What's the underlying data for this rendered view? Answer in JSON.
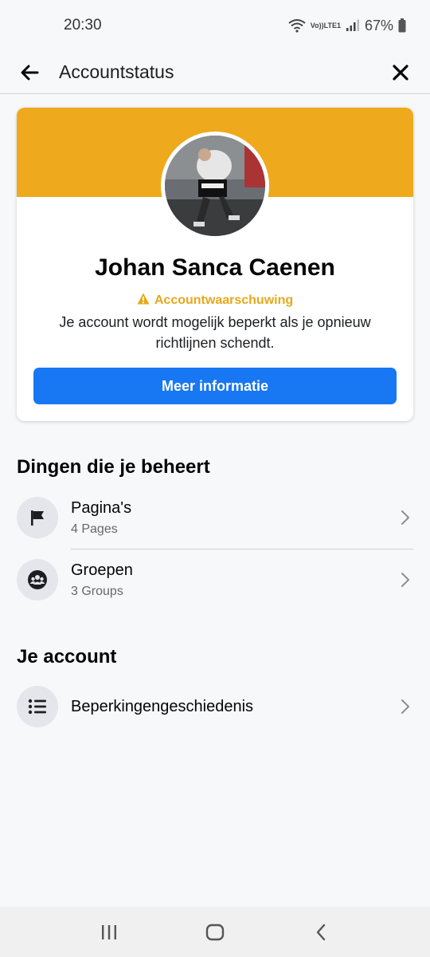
{
  "status_bar": {
    "time": "20:30",
    "volte_top": "Vo))",
    "volte_bottom": "LTE1",
    "battery": "67%"
  },
  "header": {
    "title": "Accountstatus",
    "back_icon": "arrow-left-icon",
    "close_icon": "close-icon"
  },
  "card": {
    "name": "Johan Sanca Caenen",
    "warning_label": "Accountwaarschuwing",
    "message": "Je account wordt mogelijk beperkt als je opnieuw richtlijnen schendt.",
    "button_label": "Meer informatie",
    "colors": {
      "banner": "#eeaa1c",
      "warning": "#e8a81a",
      "button": "#1877f2"
    }
  },
  "managed": {
    "title": "Dingen die je beheert",
    "items": [
      {
        "icon": "flag-icon",
        "title": "Pagina's",
        "subtitle": "4 Pages"
      },
      {
        "icon": "groups-icon",
        "title": "Groepen",
        "subtitle": "3 Groups"
      }
    ]
  },
  "account": {
    "title": "Je account",
    "items": [
      {
        "icon": "list-icon",
        "title": "Beperkingengeschiedenis"
      }
    ]
  },
  "nav": {
    "recents_icon": "recents-icon",
    "home_icon": "home-icon",
    "back_icon": "back-chevron-icon"
  }
}
